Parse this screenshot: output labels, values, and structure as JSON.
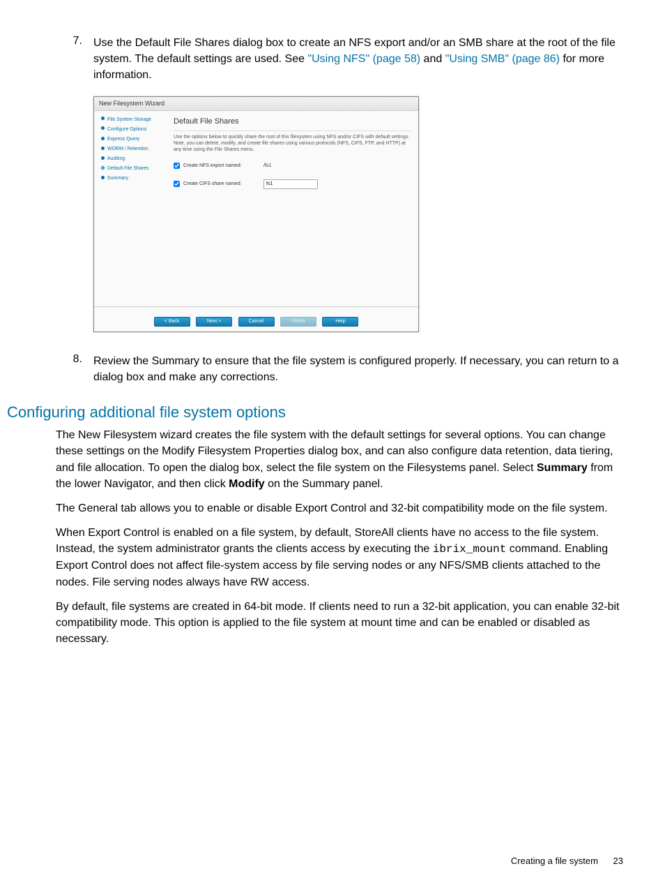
{
  "steps": {
    "seven_num": "7.",
    "seven_text_a": "Use the Default File Shares dialog box to create an NFS export and/or an SMB share at the root of the file system. The default settings are used. See ",
    "seven_link1": "\"Using NFS\" (page 58)",
    "seven_text_b": " and ",
    "seven_link2": "\"Using SMB\" (page 86)",
    "seven_text_c": " for more information.",
    "eight_num": "8.",
    "eight_text": "Review the Summary to ensure that the file system is configured properly. If necessary, you can return to a dialog box and make any corrections."
  },
  "dialog": {
    "title": "New Filesystem Wizard",
    "nav": [
      "File System Storage",
      "Configure Options",
      "Express Query",
      "WORM / Retention",
      "Auditing",
      "Default File Shares",
      "Summary"
    ],
    "heading": "Default File Shares",
    "desc": "Use the options below to quickly share the root of this filesystem using NFS and/or CIFS with default settings. Note, you can delete, modify, and create file shares using various protocols (NFS, CIFS, FTP, and HTTP) at any time using the File Shares menu.",
    "nfs_label": "Create NFS export named:",
    "nfs_value": "/fs1",
    "cifs_label": "Create CIFS share named:",
    "cifs_value": "fs1",
    "btn_back": "< Back",
    "btn_next": "Next >",
    "btn_cancel": "Cancel",
    "btn_finish": "Finish",
    "btn_help": "Help"
  },
  "section": {
    "heading": "Configuring additional file system options",
    "p1a": "The New Filesystem wizard creates the file system with the default settings for several options. You can change these settings on the Modify Filesystem Properties dialog box, and can also configure data retention, data tiering, and file allocation. To open the dialog box, select the file system on the Filesystems panel. Select ",
    "p1b_bold": "Summary",
    "p1c": " from the lower Navigator, and then click ",
    "p1d_bold": "Modify",
    "p1e": " on the Summary panel.",
    "p2": "The General tab allows you to enable or disable Export Control and 32-bit compatibility mode on the file system.",
    "p3a": "When Export Control is enabled on a file system, by default, StoreAll clients have no access to the file system. Instead, the system administrator grants the clients access by executing the ",
    "p3_code": "ibrix_mount",
    "p3b": " command. Enabling Export Control does not affect file-system access by file serving nodes or any NFS/SMB clients attached to the nodes. File serving nodes always have RW access.",
    "p4": "By default, file systems are created in 64-bit mode. If clients need to run a 32-bit application, you can enable 32-bit compatibility mode. This option is applied to the file system at mount time and can be enabled or disabled as necessary."
  },
  "footer": {
    "label": "Creating a file system",
    "page": "23"
  }
}
